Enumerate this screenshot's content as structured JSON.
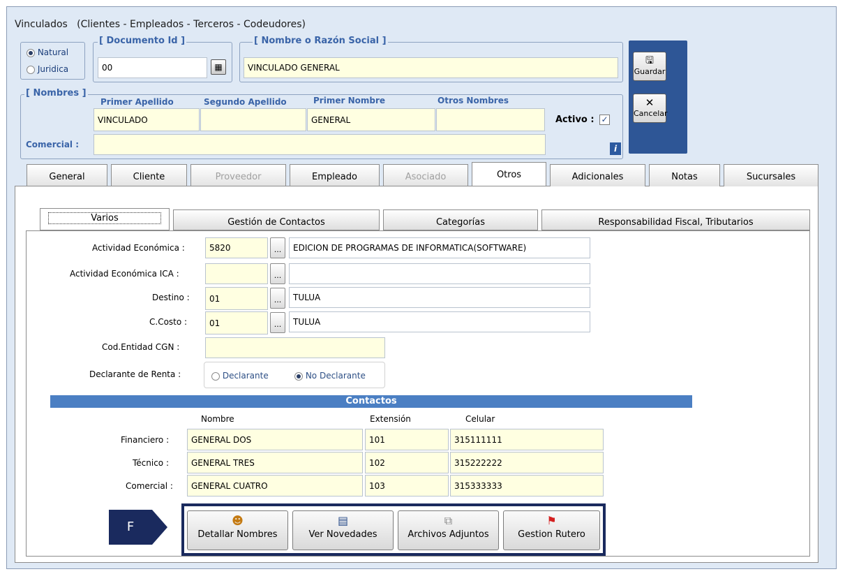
{
  "window": {
    "title": "Vinculados   (Clientes - Empleados - Terceros - Codeudores)"
  },
  "person_type": {
    "options": [
      "Natural",
      "Juridica"
    ],
    "selected": "Natural"
  },
  "documento": {
    "legend": "[ Documento Id ]",
    "value": "00"
  },
  "razon_social": {
    "legend": "[ Nombre o Razón Social ]",
    "value": "VINCULADO GENERAL"
  },
  "nombres": {
    "legend": "[ Nombres ]",
    "headers": [
      "Primer Apellido",
      "Segundo Apellido",
      "Primer Nombre",
      "Otros Nombres"
    ],
    "values": [
      "VINCULADO",
      "",
      "GENERAL",
      ""
    ],
    "comercial_label": "Comercial :",
    "comercial_value": "",
    "activo_label": "Activo :",
    "activo_checked": true,
    "info_icon": "i"
  },
  "actions": {
    "save_label": "Guardar",
    "cancel_label": "Cancelar"
  },
  "tabs": [
    {
      "label": "General",
      "enabled": true
    },
    {
      "label": "Cliente",
      "enabled": true
    },
    {
      "label": "Proveedor",
      "enabled": false
    },
    {
      "label": "Empleado",
      "enabled": true
    },
    {
      "label": "Asociado",
      "enabled": false
    },
    {
      "label": "Otros",
      "enabled": true,
      "active": true
    },
    {
      "label": "Adicionales",
      "enabled": true
    },
    {
      "label": "Notas",
      "enabled": true
    },
    {
      "label": "Sucursales",
      "enabled": true
    }
  ],
  "inner_tabs": [
    "Varios",
    "Gestión de Contactos",
    "Categorías",
    "Responsabilidad Fiscal, Tributarios"
  ],
  "varios": {
    "actividad": {
      "label": "Actividad Económica :",
      "code": "5820",
      "desc": "EDICION DE PROGRAMAS DE INFORMATICA(SOFTWARE)"
    },
    "actividad_ica": {
      "label": "Actividad Económica ICA :",
      "code": "",
      "desc": ""
    },
    "destino": {
      "label": "Destino :",
      "code": "01",
      "desc": "TULUA"
    },
    "ccosto": {
      "label": "C.Costo :",
      "code": "01",
      "desc": "TULUA"
    },
    "cgn": {
      "label": "Cod.Entidad CGN :",
      "value": ""
    },
    "renta": {
      "label": "Declarante de Renta :",
      "options": [
        "Declarante",
        "No Declarante"
      ],
      "selected": "No Declarante"
    },
    "dots_label": "..."
  },
  "contactos": {
    "title": "Contactos",
    "headers": [
      "Nombre",
      "Extensión",
      "Celular"
    ],
    "rows": [
      {
        "label": "Financiero :",
        "nombre": "GENERAL DOS",
        "ext": "101",
        "cel": "315111111"
      },
      {
        "label": "Técnico :",
        "nombre": "GENERAL TRES",
        "ext": "102",
        "cel": "315222222"
      },
      {
        "label": "Comercial :",
        "nombre": "GENERAL CUATRO",
        "ext": "103",
        "cel": "315333333"
      }
    ]
  },
  "bottom_buttons": [
    "Detallar Nombres",
    "Ver Novedades",
    "Archivos Adjuntos",
    "Gestion Rutero"
  ],
  "callout": {
    "letter": "F"
  },
  "colors": {
    "accent": "#4b7fc3",
    "field_bg": "#ffffe1",
    "callout": "#1a2a5e"
  }
}
